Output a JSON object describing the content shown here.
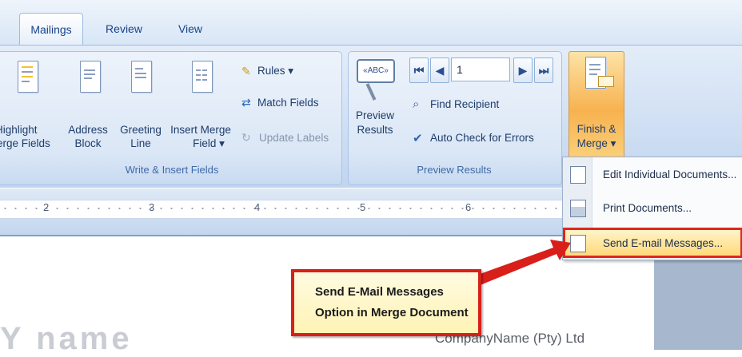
{
  "tabs": [
    {
      "label": "Mailings",
      "active": true
    },
    {
      "label": "Review",
      "active": false
    },
    {
      "label": "View",
      "active": false
    }
  ],
  "groups": {
    "write_insert": {
      "label": "Write & Insert Fields",
      "highlight": [
        "Highlight",
        "erge Fields"
      ],
      "address_block": [
        "Address",
        "Block"
      ],
      "greeting_line": [
        "Greeting",
        "Line"
      ],
      "insert_merge": [
        "Insert Merge",
        "Field ▾"
      ],
      "rules": "Rules ▾",
      "match_fields": "Match Fields",
      "update_labels": "Update Labels"
    },
    "preview": {
      "label": "Preview Results",
      "preview_btn": [
        "Preview",
        "Results"
      ],
      "record_number": "1",
      "find_recipient": "Find Recipient",
      "auto_check": "Auto Check for Errors",
      "abc_icon_text": "«ABC»"
    },
    "finish": {
      "finish_btn": [
        "Finish &",
        "Merge ▾"
      ]
    }
  },
  "ruler": {
    "numbers": [
      "2",
      "3",
      "4",
      "5",
      "6"
    ]
  },
  "menu": {
    "items": [
      {
        "label": "Edit Individual Documents...",
        "icon": "edit-documents-icon",
        "highlighted": false
      },
      {
        "label": "Print Documents...",
        "icon": "printer-icon",
        "highlighted": false
      },
      {
        "label": "Send E-mail Messages...",
        "icon": "email-icon",
        "highlighted": true
      }
    ]
  },
  "callout": {
    "line1": "Send E-Mail Messages",
    "line2": "Option in Merge Document"
  },
  "document": {
    "company": "CompanyName (Pty) Ltd",
    "watermark": "Y name"
  },
  "colors": {
    "accent_red": "#d81f1a",
    "ribbon_blue": "#c8daf1",
    "finish_orange": "#f7b24f"
  }
}
